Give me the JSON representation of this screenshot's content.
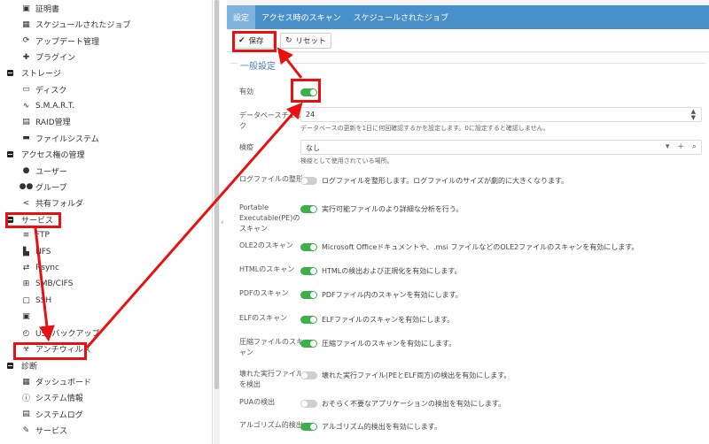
{
  "sidebar": {
    "items": [
      {
        "type": "item",
        "label": "証明書",
        "icon": "certificate-icon",
        "glyph": "▣"
      },
      {
        "type": "item",
        "label": "スケジュールされたジョブ",
        "icon": "calendar-icon",
        "glyph": "▦"
      },
      {
        "type": "item",
        "label": "アップデート管理",
        "icon": "refresh-icon",
        "glyph": "⟳"
      },
      {
        "type": "item",
        "label": "プラグイン",
        "icon": "puzzle-icon",
        "glyph": "✚"
      },
      {
        "type": "cat",
        "label": "ストレージ"
      },
      {
        "type": "item",
        "label": "ディスク",
        "icon": "disk-icon",
        "glyph": "▭"
      },
      {
        "type": "item",
        "label": "S.M.A.R.T.",
        "icon": "pulse-icon",
        "glyph": "∿"
      },
      {
        "type": "item",
        "label": "RAID管理",
        "icon": "raid-icon",
        "glyph": "▤"
      },
      {
        "type": "item",
        "label": "ファイルシステム",
        "icon": "folder-icon",
        "glyph": "▬"
      },
      {
        "type": "cat",
        "label": "アクセス権の管理"
      },
      {
        "type": "item",
        "label": "ユーザー",
        "icon": "user-icon",
        "glyph": "●"
      },
      {
        "type": "item",
        "label": "グループ",
        "icon": "group-icon",
        "glyph": "●●"
      },
      {
        "type": "item",
        "label": "共有フォルダ",
        "icon": "share-icon",
        "glyph": "<"
      },
      {
        "type": "cat",
        "label": "サービス"
      },
      {
        "type": "item",
        "label": "FTP",
        "icon": "ftp-icon",
        "glyph": "≡"
      },
      {
        "type": "item",
        "label": "NFS",
        "icon": "nfs-icon",
        "glyph": "▙"
      },
      {
        "type": "item",
        "label": "Rsync",
        "icon": "rsync-icon",
        "glyph": "⇄"
      },
      {
        "type": "item",
        "label": "SMB/CIFS",
        "icon": "windows-icon",
        "glyph": "⊞"
      },
      {
        "type": "item",
        "label": "SSH",
        "icon": "terminal-icon",
        "glyph": "▢"
      },
      {
        "type": "item",
        "label": "",
        "icon": "service-icon",
        "glyph": "▣"
      },
      {
        "type": "item",
        "label": "USBバックアップ",
        "icon": "history-icon",
        "glyph": "◴"
      },
      {
        "type": "item",
        "label": "アンチウィルス",
        "icon": "biohazard-icon",
        "glyph": "☣",
        "active": true
      },
      {
        "type": "cat",
        "label": "診断"
      },
      {
        "type": "item",
        "label": "ダッシュボード",
        "icon": "dashboard-icon",
        "glyph": "▦"
      },
      {
        "type": "item",
        "label": "システム情報",
        "icon": "info-icon",
        "glyph": "ⓘ"
      },
      {
        "type": "item",
        "label": "システムログ",
        "icon": "log-icon",
        "glyph": "▤"
      },
      {
        "type": "item",
        "label": "サービス",
        "icon": "wrench-icon",
        "glyph": "✎"
      }
    ]
  },
  "tabs": [
    "設定",
    "アクセス時のスキャン",
    "スケジュールされたジョブ"
  ],
  "toolbar": {
    "save_label": "保存",
    "reset_label": "リセット"
  },
  "form": {
    "legend": "一般設定",
    "enabled_label": "有効",
    "db_label": "データベースチェック",
    "db_value": "24",
    "db_help": "データベースの更新を1日に何回確認するかを設定します。0に設定すると確認しません。",
    "quarantine_label": "検疫",
    "quarantine_value": "なし",
    "quarantine_help": "検疫として使用されている場所。",
    "options": [
      {
        "label": "ログファイルの整形",
        "desc": "ログファイルを整形します。ログファイルのサイズが劇的に大きくなります。",
        "on": false
      },
      {
        "label": "Portable Executable(PE)のスキャン",
        "desc": "実行可能ファイルのより詳細な分析を行う。",
        "on": true
      },
      {
        "label": "OLE2のスキャン",
        "desc": "Microsoft Officeドキュメントや、.msi ファイルなどのOLE2ファイルのスキャンを有効にします。",
        "on": true
      },
      {
        "label": "HTMLのスキャン",
        "desc": "HTMLの検出および正規化を有効にします。",
        "on": true
      },
      {
        "label": "PDFのスキャン",
        "desc": "PDFファイル内のスキャンを有効にします。",
        "on": true
      },
      {
        "label": "ELFのスキャン",
        "desc": "ELFファイルのスキャンを有効にします。",
        "on": true
      },
      {
        "label": "圧縮ファイルのスキャン",
        "desc": "圧縮ファイルのスキャンを有効にします。",
        "on": true
      },
      {
        "label": "壊れた実行ファイルを検出",
        "desc": "壊れた実行ファイル(PEとELF両方)の検出を有効にします。",
        "on": false
      },
      {
        "label": "PUAの検出",
        "desc": "おそらく不要なアプリケーションの検出を有効にします。",
        "on": false
      },
      {
        "label": "アルゴリズム的検出",
        "desc": "アルゴリズム的検出を有効にします。",
        "on": true
      }
    ]
  },
  "colors": {
    "accent": "#4a90c8",
    "toggle_on": "#3cb04a",
    "annotation": "#e81010"
  }
}
